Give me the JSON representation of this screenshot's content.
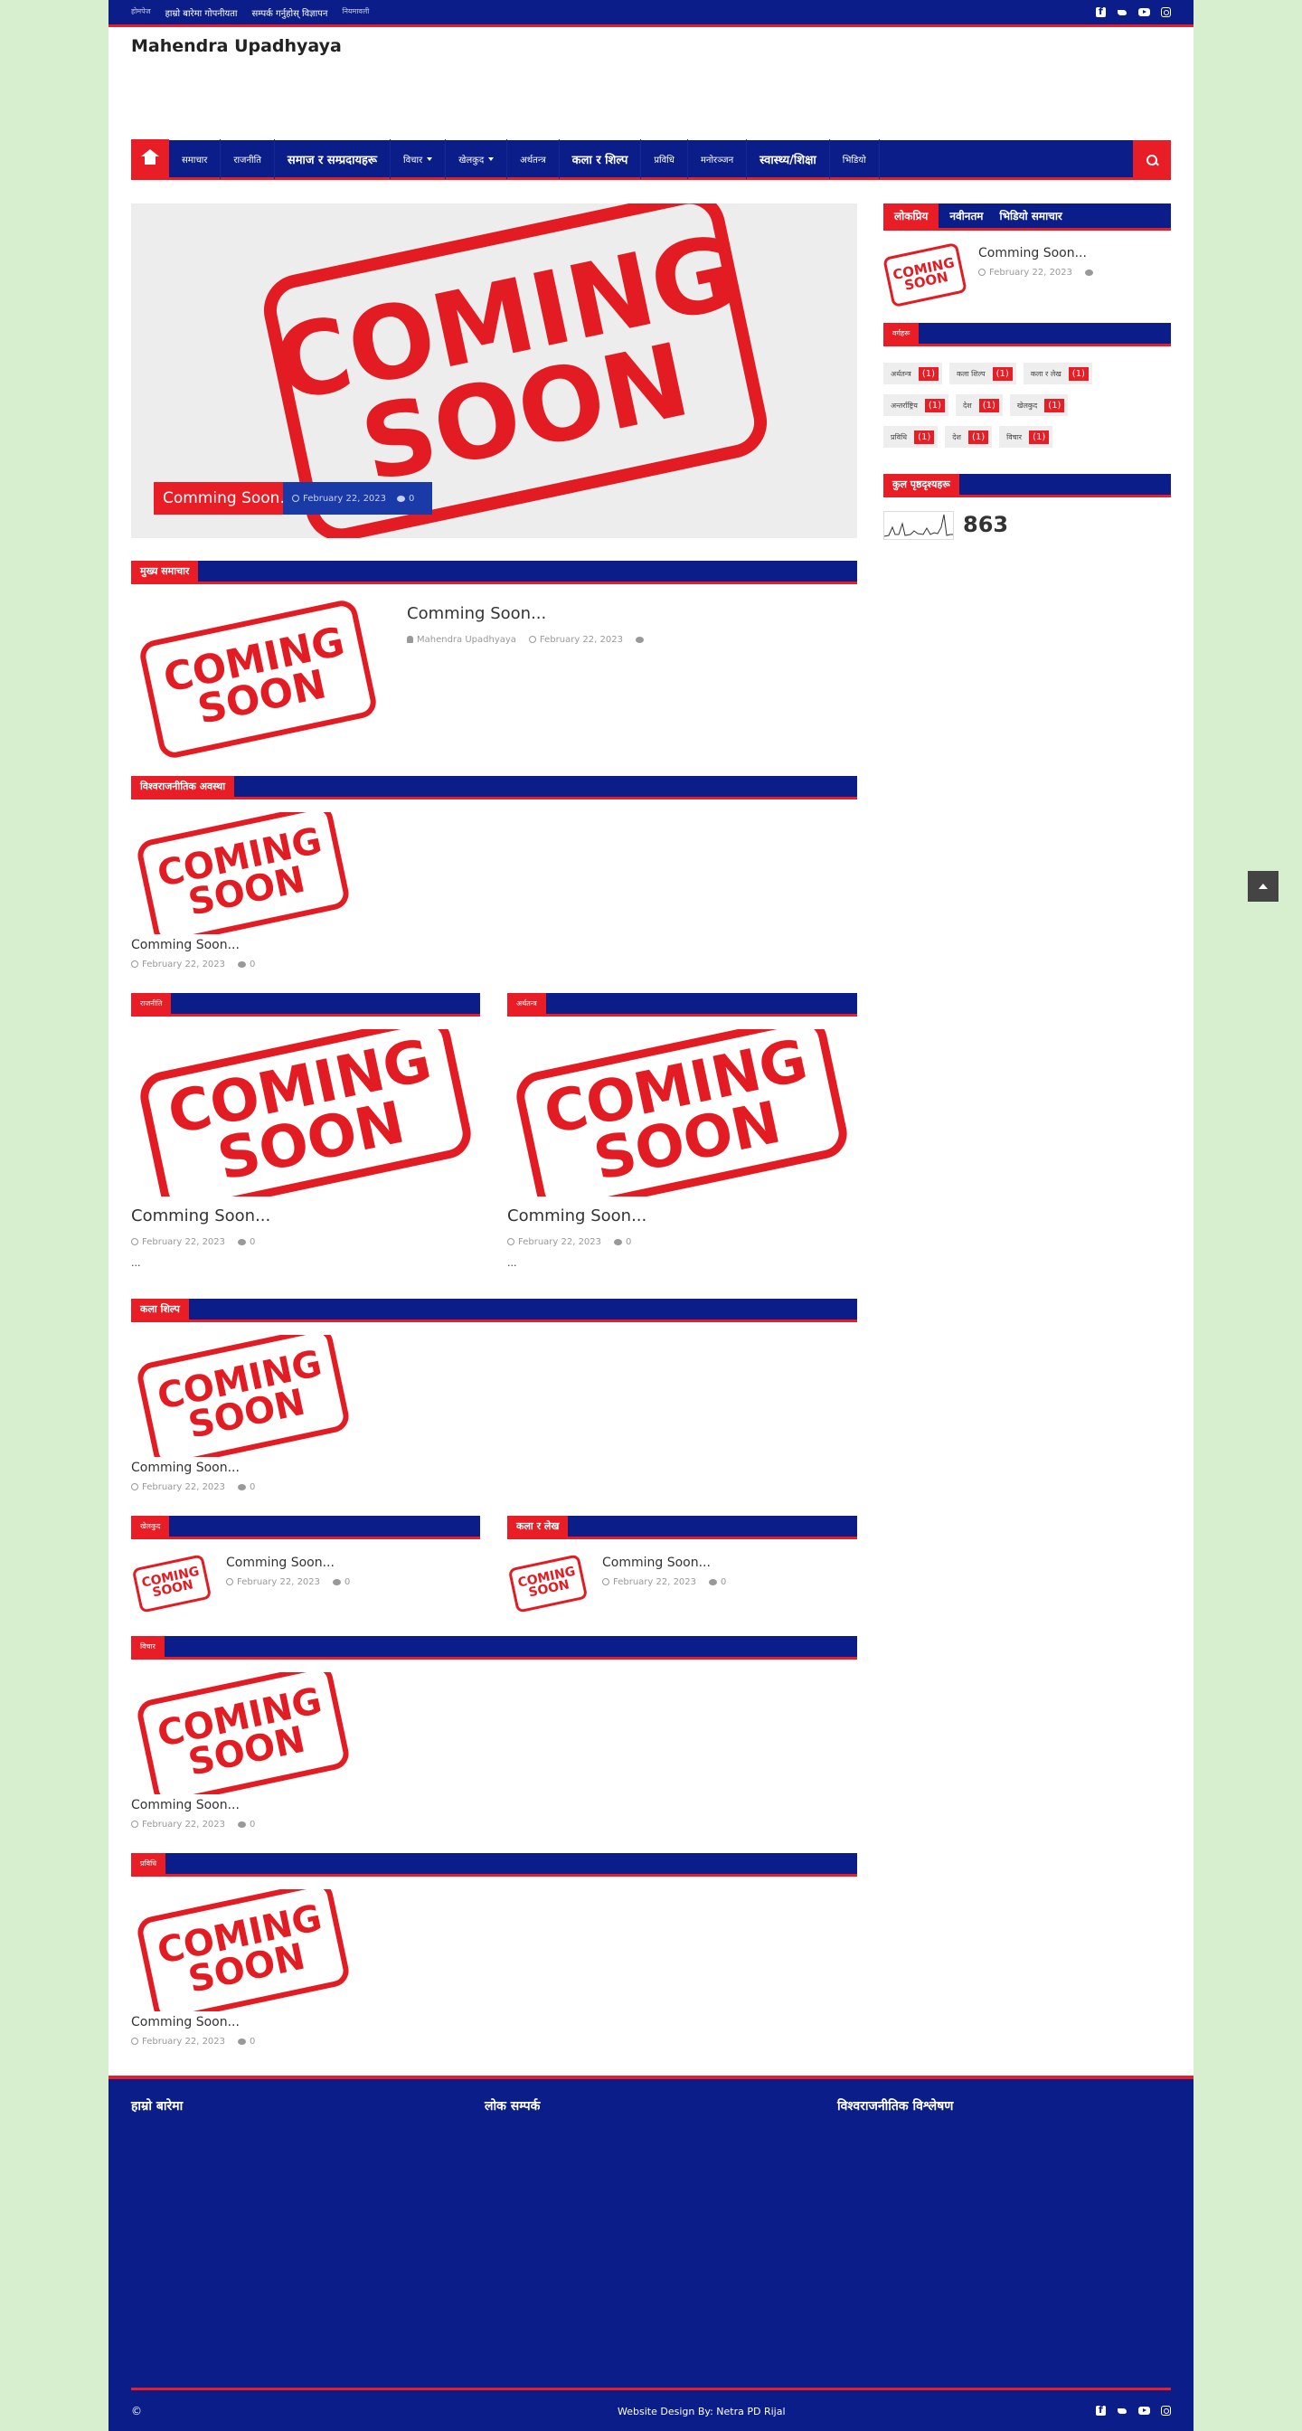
{
  "topbar": {
    "links": [
      "होमपेज",
      "हाम्रो बारेमा गोपनीयता",
      "सम्पर्क गर्नुहोस् विज्ञापन",
      "नियमावली"
    ]
  },
  "site": {
    "title": "Mahendra Upadhyaya"
  },
  "nav": {
    "items": [
      {
        "label": "समाचार",
        "big": false,
        "caret": false
      },
      {
        "label": "राजनीति",
        "big": false,
        "caret": false
      },
      {
        "label": "समाज र सम्प्रदायहरू",
        "big": true,
        "caret": false
      },
      {
        "label": "विचार",
        "big": false,
        "caret": true
      },
      {
        "label": "खेलकुद",
        "big": false,
        "caret": true
      },
      {
        "label": "अर्थतन्त्र",
        "big": false,
        "caret": false
      },
      {
        "label": "कला र शिल्प",
        "big": true,
        "caret": false
      },
      {
        "label": "प्रविधि",
        "big": false,
        "caret": false
      },
      {
        "label": "मनोरञ्जन",
        "big": false,
        "caret": false
      },
      {
        "label": "स्वास्थ्य/शिक्षा",
        "big": true,
        "caret": false
      },
      {
        "label": "भिडियो",
        "big": false,
        "caret": false
      }
    ]
  },
  "stamp": {
    "line1": "COMING",
    "line2": "SOON"
  },
  "hero": {
    "title": "Comming Soon...",
    "date": "February 22, 2023",
    "comments": "0"
  },
  "posts": {
    "title": "Comming Soon...",
    "date": "February 22, 2023",
    "author": "Mahendra Upadhyaya",
    "comments": "0",
    "more": "..."
  },
  "sections": {
    "s1": "मुख्य समाचार",
    "s2": "विश्वराजनीतिक अवस्था",
    "s3": "राजनीति",
    "s4": "अर्थतन्त्र",
    "s5": "कला शिल्प",
    "s6": "खेलकुद",
    "s7": "कला र लेख",
    "s8": "विचार",
    "s9": "प्रविधि"
  },
  "sidebar": {
    "popular_tabs": [
      "लोकप्रिय",
      "नवीनतम",
      "भिडियो समाचार"
    ],
    "labels_title": "वर्गहरू",
    "tags": [
      [
        {
          "name": "अर्थतन्त्र",
          "count": "(1)"
        },
        {
          "name": "कला शिल्प",
          "count": "(1)"
        },
        {
          "name": "कला र लेख",
          "count": "(1)"
        }
      ],
      [
        {
          "name": "अन्तर्राष्ट्रिय",
          "count": "(1)"
        },
        {
          "name": "देश",
          "count": "(1)"
        },
        {
          "name": "खेलकुद",
          "count": "(1)"
        }
      ],
      [
        {
          "name": "प्रविधि",
          "count": "(1)"
        },
        {
          "name": "देश",
          "count": "(1)"
        },
        {
          "name": "विचार",
          "count": "(1)"
        }
      ]
    ],
    "stats_title": "कुल पृष्ठदृश्यहरू",
    "stats_value": "863"
  },
  "footer": {
    "col1": "हाम्रो बारेमा",
    "col2": "लोक सम्पर्क",
    "col3": "विश्वराजनीतिक विश्लेषण",
    "copyright": "©",
    "credit": "Website Design By: Netra PD Rijal"
  }
}
